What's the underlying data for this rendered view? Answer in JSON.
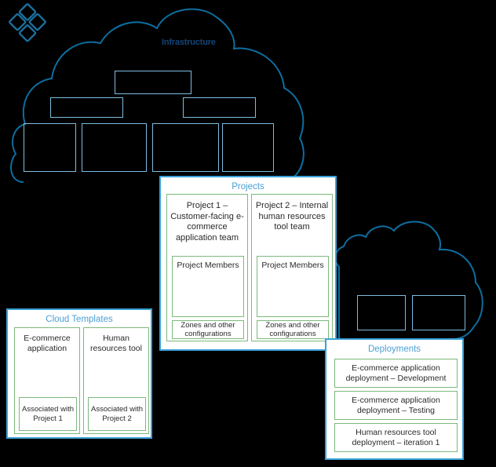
{
  "logo": {
    "name": "vmware-clover-logo",
    "color": "#1b6f9e"
  },
  "infrastructure": {
    "label": "Infrastructure",
    "label_color": "#14457a",
    "cloud_stroke": "#0d6ea0",
    "box_stroke": "#7fbce0",
    "boxes": [
      {
        "name": "infra-box-top",
        "label": ""
      },
      {
        "name": "infra-box-mid-left",
        "label": ""
      },
      {
        "name": "infra-box-mid-right",
        "label": ""
      },
      {
        "name": "infra-box-bottom-1",
        "label": ""
      },
      {
        "name": "infra-box-bottom-2",
        "label": ""
      },
      {
        "name": "infra-box-bottom-3",
        "label": ""
      },
      {
        "name": "infra-box-bottom-4",
        "label": ""
      }
    ]
  },
  "second_cloud": {
    "cloud_stroke": "#0d6ea0",
    "box_stroke": "#7fbce0",
    "boxes": [
      {
        "name": "cloud2-box-1",
        "label": ""
      },
      {
        "name": "cloud2-box-2",
        "label": ""
      }
    ]
  },
  "projects": {
    "title": "Projects",
    "title_color": "#4a9fd4",
    "panel_border": "#3aa2d8",
    "card_border": "#7cb97c",
    "items": [
      {
        "title": "Project 1 – Customer-facing e-commerce application team",
        "members_label": "Project Members",
        "members_icon": "people-group-icon",
        "zones_label": "Zones and other configurations"
      },
      {
        "title": "Project 2 – Internal human resources tool team",
        "members_label": "Project Members",
        "members_icon": "people-group-icon",
        "zones_label": "Zones and other configurations"
      }
    ]
  },
  "cloud_templates": {
    "title": "Cloud Templates",
    "title_color": "#4a9fd4",
    "panel_border": "#3aa2d8",
    "card_border": "#7cb97c",
    "items": [
      {
        "title": "E-commerce application",
        "icon": "blueprint-stack-icon",
        "association": "Associated with Project 1"
      },
      {
        "title": "Human resources tool",
        "icon": "blueprint-stack-icon",
        "association": "Associated with Project 2"
      }
    ]
  },
  "deployments": {
    "title": "Deployments",
    "title_color": "#4a9fd4",
    "panel_border": "#3aa2d8",
    "card_border": "#7cb97c",
    "items": [
      {
        "label": "E-commerce application deployment – Development"
      },
      {
        "label": "E-commerce application deployment – Testing"
      },
      {
        "label": "Human resources tool deployment – iteration 1"
      }
    ]
  }
}
